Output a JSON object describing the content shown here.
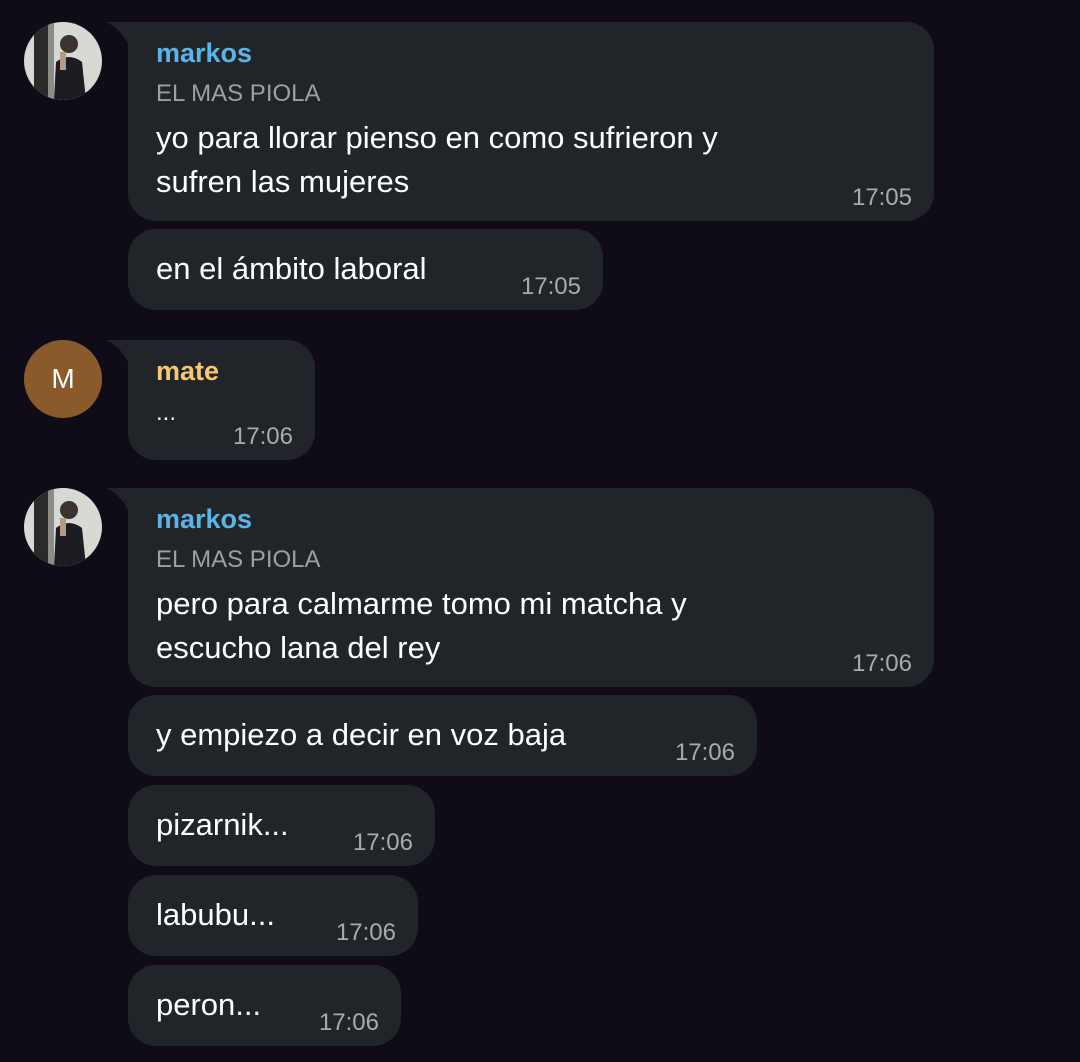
{
  "colors": {
    "background": "#0f0c17",
    "bubble": "#212529",
    "markos_name": "#5bb4e6",
    "mate_name": "#f7c874",
    "mate_avatar": "#8a5a2b"
  },
  "groups": [
    {
      "sender": "markos",
      "subtitle": "EL MAS PIOLA",
      "messages": [
        {
          "text": "yo para llorar pienso en como sufrieron y\nsufren las mujeres",
          "time": "17:05"
        },
        {
          "text": "en el ámbito laboral",
          "time": "17:05"
        }
      ]
    },
    {
      "sender": "mate",
      "avatar_letter": "M",
      "messages": [
        {
          "text": "...",
          "time": "17:06"
        }
      ]
    },
    {
      "sender": "markos",
      "subtitle": "EL MAS PIOLA",
      "messages": [
        {
          "text": "pero para calmarme tomo mi matcha y\nescucho lana del rey",
          "time": "17:06"
        },
        {
          "text": "y empiezo a decir en voz baja",
          "time": "17:06"
        },
        {
          "text": "pizarnik...",
          "time": "17:06"
        },
        {
          "text": "labubu...",
          "time": "17:06"
        },
        {
          "text": "peron...",
          "time": "17:06"
        }
      ]
    }
  ]
}
